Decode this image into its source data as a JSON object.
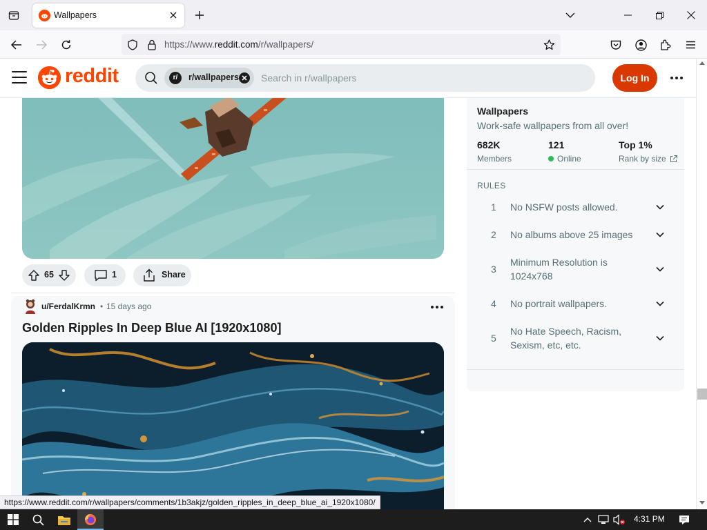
{
  "browser": {
    "tab_title": "Wallpapers",
    "url_prefix": "https://www.",
    "url_domain": "reddit.com",
    "url_path": "/r/wallpapers/",
    "status_url": "https://www.reddit.com/r/wallpapers/comments/1b3akjz/golden_ripples_in_deep_blue_ai_1920x1080/"
  },
  "header": {
    "logo_text": "reddit",
    "chip_avatar": "r/",
    "chip_label": "r/wallpapers",
    "search_placeholder": "Search in r/wallpapers",
    "login_label": "Log In",
    "brand_color": "#ff4500"
  },
  "post1": {
    "votes": "65",
    "comments": "1",
    "share_label": "Share"
  },
  "post2": {
    "author": "u/FerdalKrmn",
    "dot": "•",
    "time": "15 days ago",
    "title": "Golden Ripples In Deep Blue AI [1920x1080]"
  },
  "sidebar": {
    "title": "Wallpapers",
    "description": "Work-safe wallpapers from all over!",
    "stats": [
      {
        "value": "682K",
        "label": "Members"
      },
      {
        "value": "121",
        "label": "Online"
      },
      {
        "value": "Top 1%",
        "label": "Rank by size"
      }
    ],
    "rules_header": "RULES",
    "rules": [
      {
        "num": "1",
        "text": "No NSFW posts allowed."
      },
      {
        "num": "2",
        "text": "No albums above 25 images"
      },
      {
        "num": "3",
        "text": "Minimum Resolution is 1024x768"
      },
      {
        "num": "4",
        "text": "No portrait wallpapers."
      },
      {
        "num": "5",
        "text": "No Hate Speech, Racism, Sexism, etc, etc."
      }
    ]
  },
  "taskbar": {
    "clock": "4:31 PM"
  }
}
